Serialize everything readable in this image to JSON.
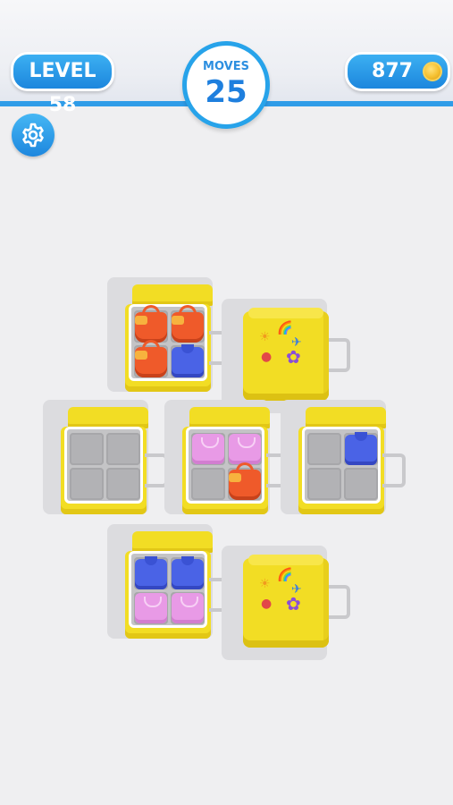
{
  "header": {
    "level_label": "LEVEL 58",
    "moves_label": "MOVES",
    "moves_value": "25",
    "coins_value": "877"
  },
  "icons": {
    "settings": "gear-icon",
    "coin": "coin-icon"
  },
  "colors": {
    "accent": "#2f9ce8",
    "suitcase": "#f2dd24",
    "tray": "#c4c4c6",
    "blue_sweater": "#4a63e6",
    "pink_sweater": "#e89ae6",
    "red_bag": "#ef5a2a"
  },
  "board": {
    "suitcases": [
      {
        "state": "open",
        "items": [
          "red-bag",
          "red-bag",
          "red-bag",
          "blue-sweater"
        ]
      },
      {
        "state": "closed",
        "items": []
      },
      {
        "state": "open",
        "items": [
          "",
          "",
          "",
          ""
        ]
      },
      {
        "state": "open",
        "items": [
          "pink-sweater",
          "pink-sweater",
          "",
          "red-bag"
        ]
      },
      {
        "state": "open",
        "items": [
          "",
          "blue-sweater",
          "",
          ""
        ]
      },
      {
        "state": "open",
        "items": [
          "blue-sweater",
          "blue-sweater",
          "pink-sweater",
          "pink-sweater"
        ]
      },
      {
        "state": "closed",
        "items": []
      }
    ]
  }
}
